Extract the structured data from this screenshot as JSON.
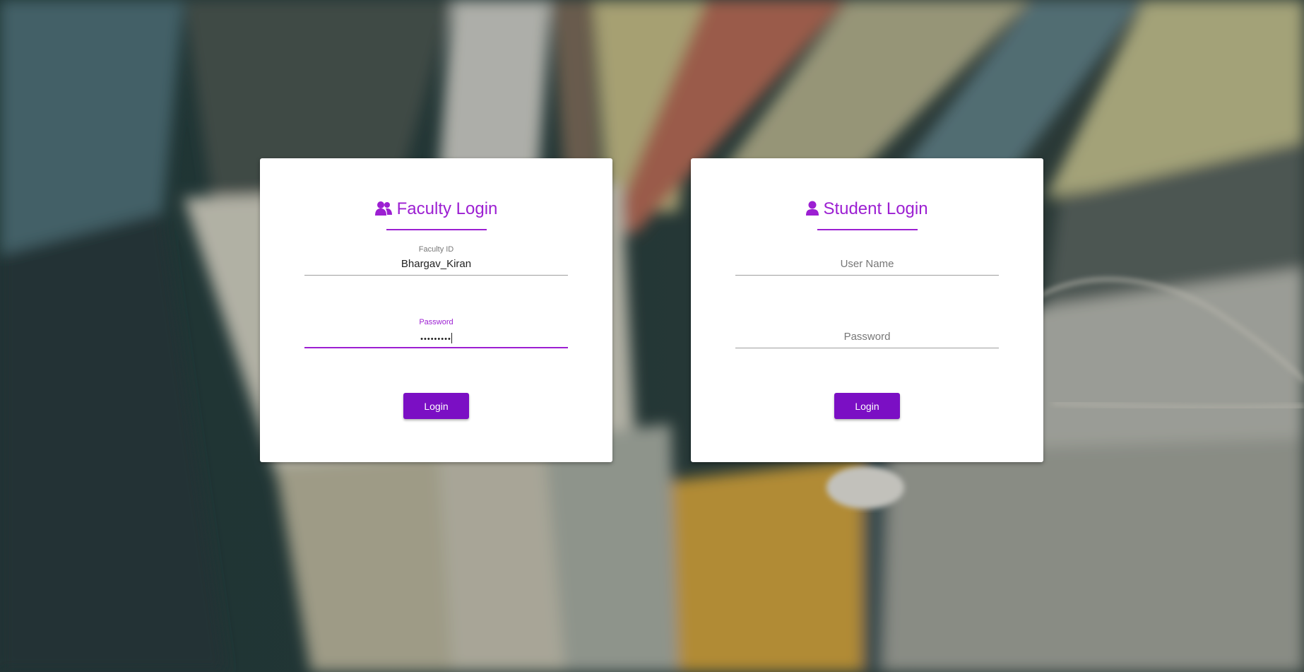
{
  "faculty": {
    "title": "Faculty Login",
    "id_label": "Faculty ID",
    "id_value": "Bhargav_Kiran",
    "password_label": "Password",
    "password_value": "•••••••••",
    "login_label": "Login"
  },
  "student": {
    "title": "Student Login",
    "username_placeholder": "User Name",
    "password_placeholder": "Password",
    "login_label": "Login"
  },
  "colors": {
    "accent": "#9c1fd2",
    "button": "#7b0fc4"
  },
  "icons": {
    "faculty": "users-icon",
    "student": "user-icon"
  }
}
